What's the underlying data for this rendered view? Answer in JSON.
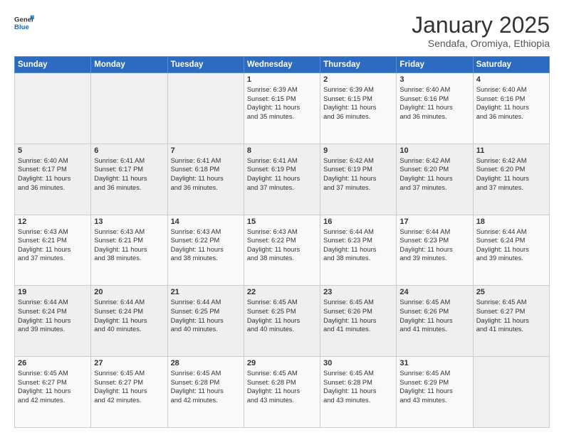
{
  "logo": {
    "line1": "General",
    "line2": "Blue"
  },
  "title": "January 2025",
  "subtitle": "Sendafa, Oromiya, Ethiopia",
  "days_of_week": [
    "Sunday",
    "Monday",
    "Tuesday",
    "Wednesday",
    "Thursday",
    "Friday",
    "Saturday"
  ],
  "weeks": [
    [
      {
        "day": "",
        "content": ""
      },
      {
        "day": "",
        "content": ""
      },
      {
        "day": "",
        "content": ""
      },
      {
        "day": "1",
        "content": "Sunrise: 6:39 AM\nSunset: 6:15 PM\nDaylight: 11 hours\nand 35 minutes."
      },
      {
        "day": "2",
        "content": "Sunrise: 6:39 AM\nSunset: 6:15 PM\nDaylight: 11 hours\nand 36 minutes."
      },
      {
        "day": "3",
        "content": "Sunrise: 6:40 AM\nSunset: 6:16 PM\nDaylight: 11 hours\nand 36 minutes."
      },
      {
        "day": "4",
        "content": "Sunrise: 6:40 AM\nSunset: 6:16 PM\nDaylight: 11 hours\nand 36 minutes."
      }
    ],
    [
      {
        "day": "5",
        "content": "Sunrise: 6:40 AM\nSunset: 6:17 PM\nDaylight: 11 hours\nand 36 minutes."
      },
      {
        "day": "6",
        "content": "Sunrise: 6:41 AM\nSunset: 6:17 PM\nDaylight: 11 hours\nand 36 minutes."
      },
      {
        "day": "7",
        "content": "Sunrise: 6:41 AM\nSunset: 6:18 PM\nDaylight: 11 hours\nand 36 minutes."
      },
      {
        "day": "8",
        "content": "Sunrise: 6:41 AM\nSunset: 6:19 PM\nDaylight: 11 hours\nand 37 minutes."
      },
      {
        "day": "9",
        "content": "Sunrise: 6:42 AM\nSunset: 6:19 PM\nDaylight: 11 hours\nand 37 minutes."
      },
      {
        "day": "10",
        "content": "Sunrise: 6:42 AM\nSunset: 6:20 PM\nDaylight: 11 hours\nand 37 minutes."
      },
      {
        "day": "11",
        "content": "Sunrise: 6:42 AM\nSunset: 6:20 PM\nDaylight: 11 hours\nand 37 minutes."
      }
    ],
    [
      {
        "day": "12",
        "content": "Sunrise: 6:43 AM\nSunset: 6:21 PM\nDaylight: 11 hours\nand 37 minutes."
      },
      {
        "day": "13",
        "content": "Sunrise: 6:43 AM\nSunset: 6:21 PM\nDaylight: 11 hours\nand 38 minutes."
      },
      {
        "day": "14",
        "content": "Sunrise: 6:43 AM\nSunset: 6:22 PM\nDaylight: 11 hours\nand 38 minutes."
      },
      {
        "day": "15",
        "content": "Sunrise: 6:43 AM\nSunset: 6:22 PM\nDaylight: 11 hours\nand 38 minutes."
      },
      {
        "day": "16",
        "content": "Sunrise: 6:44 AM\nSunset: 6:23 PM\nDaylight: 11 hours\nand 38 minutes."
      },
      {
        "day": "17",
        "content": "Sunrise: 6:44 AM\nSunset: 6:23 PM\nDaylight: 11 hours\nand 39 minutes."
      },
      {
        "day": "18",
        "content": "Sunrise: 6:44 AM\nSunset: 6:24 PM\nDaylight: 11 hours\nand 39 minutes."
      }
    ],
    [
      {
        "day": "19",
        "content": "Sunrise: 6:44 AM\nSunset: 6:24 PM\nDaylight: 11 hours\nand 39 minutes."
      },
      {
        "day": "20",
        "content": "Sunrise: 6:44 AM\nSunset: 6:24 PM\nDaylight: 11 hours\nand 40 minutes."
      },
      {
        "day": "21",
        "content": "Sunrise: 6:44 AM\nSunset: 6:25 PM\nDaylight: 11 hours\nand 40 minutes."
      },
      {
        "day": "22",
        "content": "Sunrise: 6:45 AM\nSunset: 6:25 PM\nDaylight: 11 hours\nand 40 minutes."
      },
      {
        "day": "23",
        "content": "Sunrise: 6:45 AM\nSunset: 6:26 PM\nDaylight: 11 hours\nand 41 minutes."
      },
      {
        "day": "24",
        "content": "Sunrise: 6:45 AM\nSunset: 6:26 PM\nDaylight: 11 hours\nand 41 minutes."
      },
      {
        "day": "25",
        "content": "Sunrise: 6:45 AM\nSunset: 6:27 PM\nDaylight: 11 hours\nand 41 minutes."
      }
    ],
    [
      {
        "day": "26",
        "content": "Sunrise: 6:45 AM\nSunset: 6:27 PM\nDaylight: 11 hours\nand 42 minutes."
      },
      {
        "day": "27",
        "content": "Sunrise: 6:45 AM\nSunset: 6:27 PM\nDaylight: 11 hours\nand 42 minutes."
      },
      {
        "day": "28",
        "content": "Sunrise: 6:45 AM\nSunset: 6:28 PM\nDaylight: 11 hours\nand 42 minutes."
      },
      {
        "day": "29",
        "content": "Sunrise: 6:45 AM\nSunset: 6:28 PM\nDaylight: 11 hours\nand 43 minutes."
      },
      {
        "day": "30",
        "content": "Sunrise: 6:45 AM\nSunset: 6:28 PM\nDaylight: 11 hours\nand 43 minutes."
      },
      {
        "day": "31",
        "content": "Sunrise: 6:45 AM\nSunset: 6:29 PM\nDaylight: 11 hours\nand 43 minutes."
      },
      {
        "day": "",
        "content": ""
      }
    ]
  ]
}
